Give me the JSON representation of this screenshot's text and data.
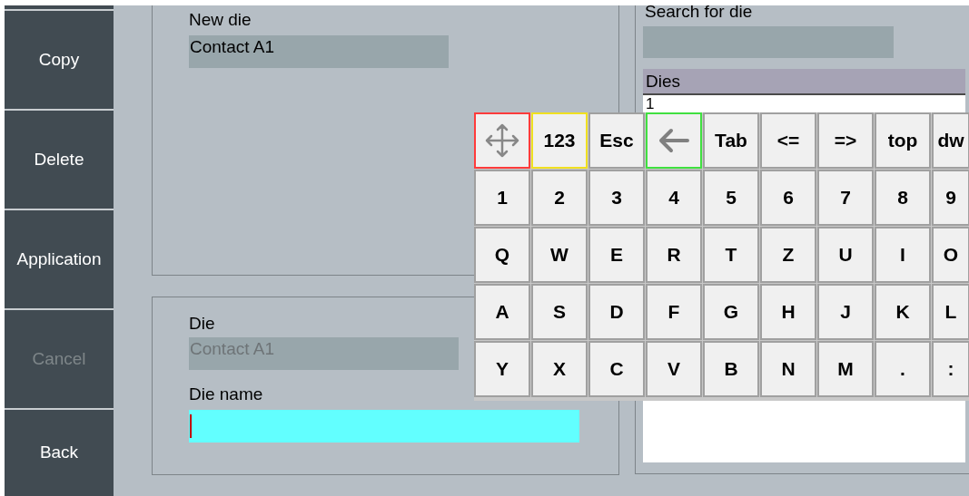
{
  "sidebar": {
    "buttons": [
      {
        "label": "Copy",
        "disabled": false
      },
      {
        "label": "Delete",
        "disabled": false
      },
      {
        "label": "Application",
        "disabled": false
      },
      {
        "label": "Cancel",
        "disabled": true
      },
      {
        "label": "Back",
        "disabled": false
      }
    ]
  },
  "new_die": {
    "label": "New die",
    "value": "Contact A1"
  },
  "die_panel": {
    "die_label": "Die",
    "die_value": "Contact A1",
    "die_disabled": true,
    "name_label": "Die name",
    "name_focused": true
  },
  "search": {
    "label": "Search for die"
  },
  "dies_list": {
    "header": "Dies",
    "rows": [
      "1"
    ]
  },
  "keyboard": {
    "rows": [
      [
        {
          "kind": "move",
          "color": "#ff3b3b"
        },
        {
          "kind": "text",
          "label": "123",
          "color": "#f0e020"
        },
        {
          "kind": "text",
          "label": "Esc"
        },
        {
          "kind": "backspace",
          "color": "#40e040"
        },
        {
          "kind": "text",
          "label": "Tab"
        },
        {
          "kind": "text",
          "label": "<="
        },
        {
          "kind": "text",
          "label": "=>"
        },
        {
          "kind": "text",
          "label": "top"
        },
        {
          "kind": "text",
          "label": "dw"
        }
      ],
      [
        {
          "kind": "text",
          "label": "1"
        },
        {
          "kind": "text",
          "label": "2"
        },
        {
          "kind": "text",
          "label": "3"
        },
        {
          "kind": "text",
          "label": "4"
        },
        {
          "kind": "text",
          "label": "5"
        },
        {
          "kind": "text",
          "label": "6"
        },
        {
          "kind": "text",
          "label": "7"
        },
        {
          "kind": "text",
          "label": "8"
        },
        {
          "kind": "text",
          "label": "9"
        }
      ],
      [
        {
          "kind": "text",
          "label": "Q"
        },
        {
          "kind": "text",
          "label": "W"
        },
        {
          "kind": "text",
          "label": "E"
        },
        {
          "kind": "text",
          "label": "R"
        },
        {
          "kind": "text",
          "label": "T"
        },
        {
          "kind": "text",
          "label": "Z"
        },
        {
          "kind": "text",
          "label": "U"
        },
        {
          "kind": "text",
          "label": "I"
        },
        {
          "kind": "text",
          "label": "O"
        }
      ],
      [
        {
          "kind": "text",
          "label": "A"
        },
        {
          "kind": "text",
          "label": "S"
        },
        {
          "kind": "text",
          "label": "D"
        },
        {
          "kind": "text",
          "label": "F"
        },
        {
          "kind": "text",
          "label": "G"
        },
        {
          "kind": "text",
          "label": "H"
        },
        {
          "kind": "text",
          "label": "J"
        },
        {
          "kind": "text",
          "label": "K"
        },
        {
          "kind": "text",
          "label": "L"
        }
      ],
      [
        {
          "kind": "text",
          "label": "Y"
        },
        {
          "kind": "text",
          "label": "X"
        },
        {
          "kind": "text",
          "label": "C"
        },
        {
          "kind": "text",
          "label": "V"
        },
        {
          "kind": "text",
          "label": "B"
        },
        {
          "kind": "text",
          "label": "N"
        },
        {
          "kind": "text",
          "label": "M"
        },
        {
          "kind": "text",
          "label": "."
        },
        {
          "kind": "text",
          "label": ":"
        }
      ]
    ]
  }
}
